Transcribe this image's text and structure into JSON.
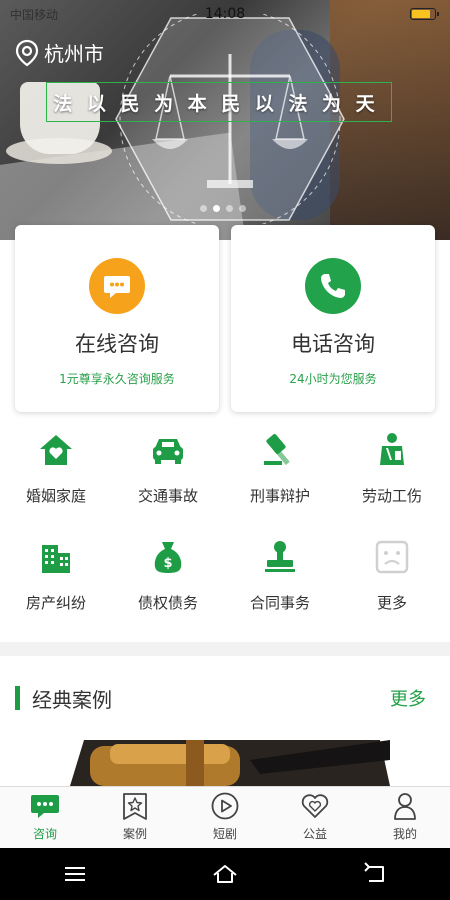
{
  "status_bar": {
    "time": "14:08",
    "left": "中国移动",
    "battery_level": 0.85
  },
  "banner": {
    "city": "杭州市",
    "slogan": [
      "法",
      "以",
      "民",
      "为",
      "本",
      "民",
      "以",
      "法",
      "为",
      "天"
    ],
    "slides_total": 4,
    "slide_active": 1
  },
  "consult": [
    {
      "title": "在线咨询",
      "subtitle": "1元尊享永久咨询服务",
      "icon": "chat-bubble-icon",
      "color": "#f7a21b"
    },
    {
      "title": "电话咨询",
      "subtitle": "24小时为您服务",
      "icon": "phone-icon",
      "color": "#22a24a"
    }
  ],
  "categories": [
    {
      "label": "婚姻家庭",
      "icon": "house-heart-icon"
    },
    {
      "label": "交通事故",
      "icon": "car-icon"
    },
    {
      "label": "刑事辩护",
      "icon": "gavel-icon"
    },
    {
      "label": "劳动工伤",
      "icon": "worker-icon"
    },
    {
      "label": "房产纠纷",
      "icon": "building-icon"
    },
    {
      "label": "债权债务",
      "icon": "money-bag-icon"
    },
    {
      "label": "合同事务",
      "icon": "stamp-icon"
    },
    {
      "label": "更多",
      "icon": "more-face-icon"
    }
  ],
  "cases": {
    "title": "经典案例",
    "more": "更多"
  },
  "tabs": [
    {
      "label": "咨询",
      "icon": "consult-icon",
      "active": true
    },
    {
      "label": "案例",
      "icon": "case-star-icon",
      "active": false
    },
    {
      "label": "短剧",
      "icon": "play-icon",
      "active": false
    },
    {
      "label": "公益",
      "icon": "heart-icon",
      "active": false
    },
    {
      "label": "我的",
      "icon": "profile-icon",
      "active": false
    }
  ],
  "colors": {
    "brand_green": "#1f9d46",
    "accent_orange": "#f7a21b",
    "muted_gray": "#cfcfcf"
  }
}
